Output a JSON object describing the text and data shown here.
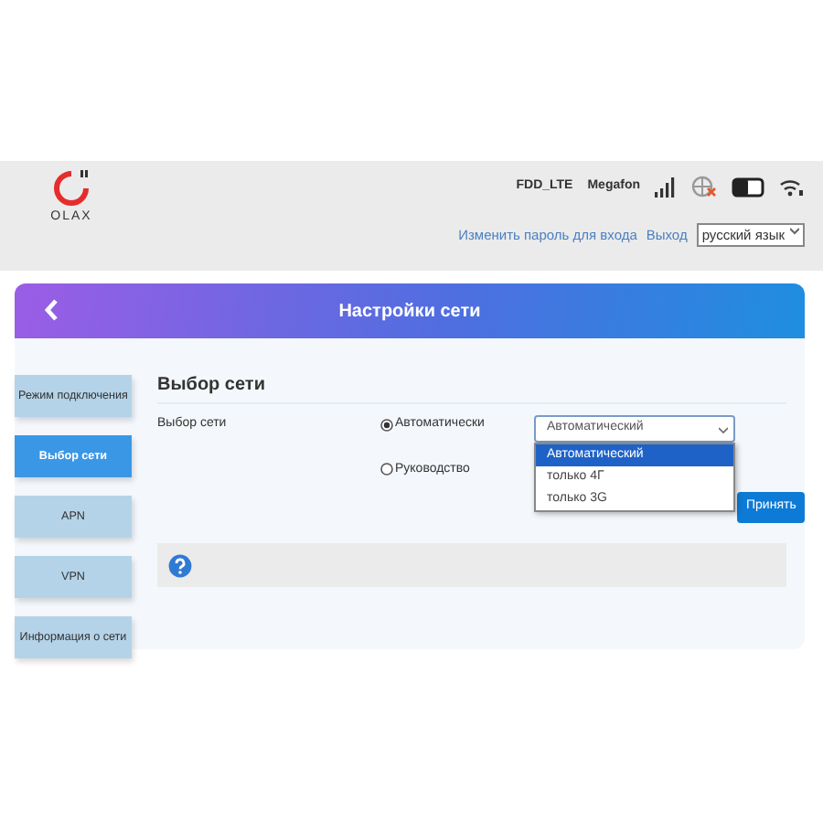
{
  "header": {
    "logo_text": "OLAX",
    "network_type": "FDD_LTE",
    "operator": "Megafon",
    "links": [
      "Изменить пароль для входа",
      "Выход"
    ],
    "language": "русский язык"
  },
  "panel": {
    "title": "Настройки сети"
  },
  "sidebar": {
    "items": [
      {
        "label": "Режим подключения",
        "selected": false
      },
      {
        "label": "Выбор сети",
        "selected": true
      },
      {
        "label": "APN",
        "selected": false
      },
      {
        "label": "VPN",
        "selected": false
      },
      {
        "label": "Информация о сети",
        "selected": false
      }
    ]
  },
  "content": {
    "heading": "Выбор сети",
    "field_label": "Выбор сети",
    "radios": [
      {
        "label": "Автоматически",
        "checked": true
      },
      {
        "label": "Руководство",
        "checked": false
      }
    ],
    "select": {
      "value": "Автоматический",
      "expanded": true,
      "options": [
        {
          "label": "Автоматический",
          "selected": true
        },
        {
          "label": "только 4Г",
          "selected": false
        },
        {
          "label": "только 3G",
          "selected": false
        }
      ]
    },
    "apply_button": "Принять"
  }
}
